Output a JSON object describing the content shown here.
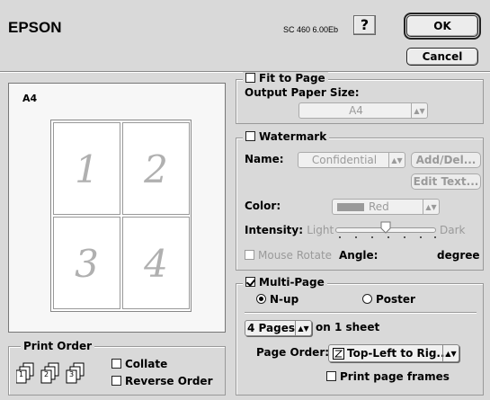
{
  "header": {
    "brand": "EPSON",
    "version": "SC 460 6.00Eb",
    "help_glyph": "?",
    "ok_label": "OK",
    "cancel_label": "Cancel"
  },
  "preview": {
    "paper_label": "A4",
    "pages": [
      "1",
      "2",
      "3",
      "4"
    ]
  },
  "fit_to_page": {
    "title": "Fit to Page",
    "checked": false,
    "output_label": "Output Paper Size:",
    "output_value": "A4"
  },
  "watermark": {
    "title": "Watermark",
    "checked": false,
    "name_label": "Name:",
    "name_value": "Confidential",
    "add_del_label": "Add/Del...",
    "edit_text_label": "Edit Text...",
    "color_label": "Color:",
    "color_value": "Red",
    "color_swatch": "#9a9a9a",
    "intensity_label": "Intensity:",
    "light_label": "Light",
    "dark_label": "Dark",
    "intensity_level": 0.5,
    "mouse_rotate_label": "Mouse Rotate",
    "angle_label": "Angle:",
    "degree_label": "degree"
  },
  "multi_page": {
    "title": "Multi-Page",
    "checked": true,
    "nup_label": "N-up",
    "poster_label": "Poster",
    "selected_mode": "N-up",
    "pages_value": "4 Pages",
    "on_sheet_label": "on 1 sheet",
    "page_order_label": "Page Order:",
    "page_order_value": "Top-Left to Rig...",
    "print_frames_label": "Print page frames",
    "print_frames_checked": false
  },
  "print_order": {
    "title": "Print Order",
    "collate_label": "Collate",
    "reverse_label": "Reverse Order",
    "collate_checked": false,
    "reverse_checked": false,
    "icons": [
      "1",
      "2",
      "3"
    ]
  }
}
